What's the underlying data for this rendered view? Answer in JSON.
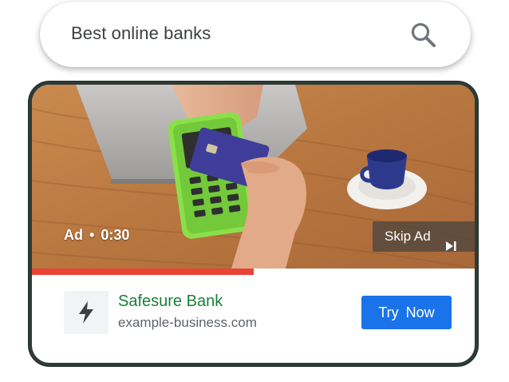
{
  "search": {
    "query": "Best online banks",
    "icon": "search-icon"
  },
  "ad": {
    "label": "Ad",
    "separator": "•",
    "time": "0:30",
    "skip_label": "Skip Ad",
    "skip_icon": "skip-next-icon",
    "progress_fraction": 0.5,
    "advertiser": {
      "name": "Safesure Bank",
      "url": "example-business.com",
      "logo_icon": "lightning-bolt-icon"
    },
    "cta_label": "Try Now"
  },
  "colors": {
    "progress": "#ea4335",
    "advertiser_name": "#188038",
    "cta_background": "#1a73e8",
    "card_frame": "#2f3b36"
  }
}
